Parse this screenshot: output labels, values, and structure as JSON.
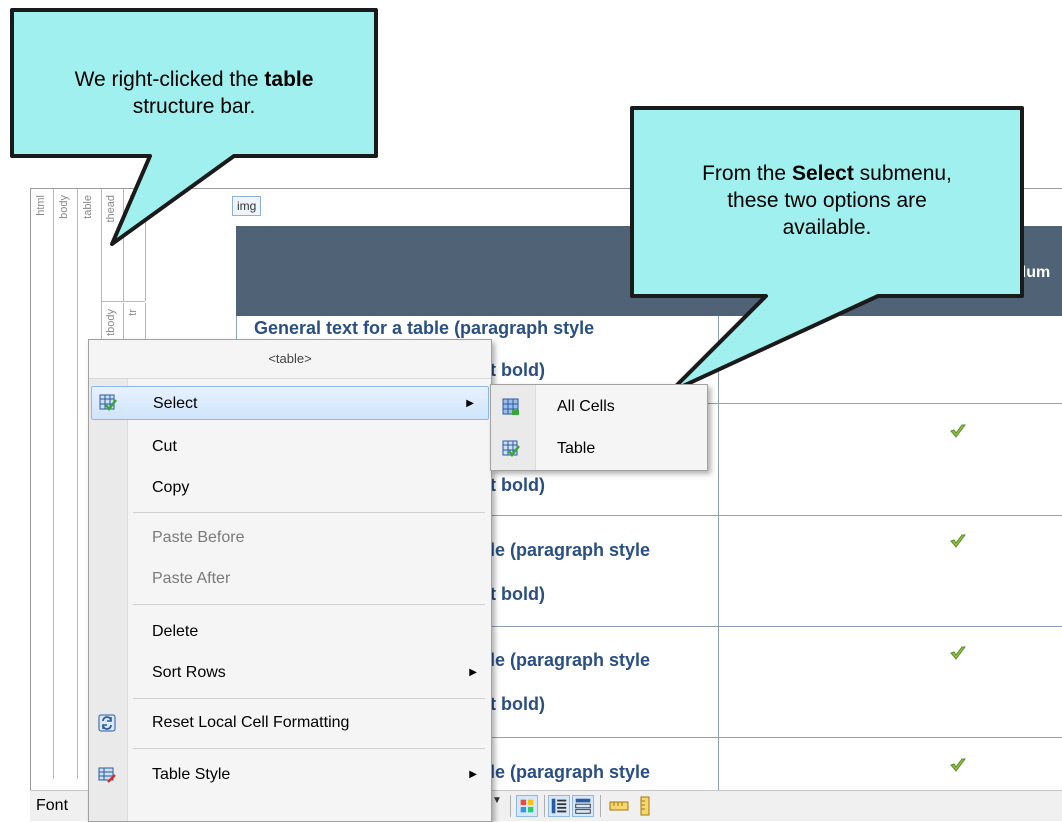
{
  "callout_left": {
    "line1_prefix": "We right-clicked the ",
    "line1_bold": "table",
    "line2": "structure bar."
  },
  "callout_right": {
    "line1_prefix": "From the ",
    "line1_bold": "Select",
    "line1_suffix": " submenu,",
    "line2": "these two options are",
    "line3": "available."
  },
  "structure_bars": [
    "html",
    "body",
    "table",
    "thead",
    "tr",
    "tbody",
    "tr"
  ],
  "img_tag": "img",
  "document": {
    "header_partial": "olum",
    "row_text_1": "General text for a table (paragraph style",
    "row_text_partial_bold": "t bold)",
    "row_text_partial_style": "le (paragraph style"
  },
  "context_menu": {
    "header": "<table>",
    "items": [
      {
        "label": "Select",
        "icon": "select-table-icon",
        "submenu": true,
        "highlighted": true
      },
      {
        "label": "Cut"
      },
      {
        "label": "Copy"
      },
      {
        "label": "Paste Before",
        "disabled": true
      },
      {
        "label": "Paste After",
        "disabled": true
      },
      {
        "label": "Delete"
      },
      {
        "label": "Sort Rows",
        "submenu": true
      },
      {
        "label": "Reset Local Cell Formatting",
        "icon": "reset-formatting-icon"
      },
      {
        "label": "Table Style",
        "icon": "table-style-icon",
        "submenu": true
      }
    ]
  },
  "submenu": {
    "items": [
      {
        "label": "All Cells",
        "icon": "all-cells-icon"
      },
      {
        "label": "Table",
        "icon": "select-table-icon"
      }
    ]
  },
  "toolbar": {
    "font_label": "Font"
  },
  "colors": {
    "callout_fill": "#9ff0ee",
    "table_header": "#4f6276",
    "table_text": "#2a4f82",
    "menu_highlight": "#cfe4fb"
  }
}
